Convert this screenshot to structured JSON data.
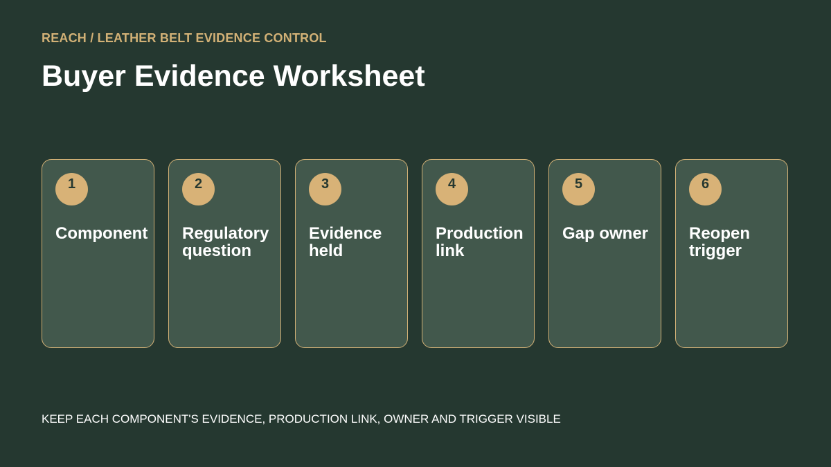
{
  "header": {
    "eyebrow": "REACH / LEATHER BELT EVIDENCE CONTROL",
    "title": "Buyer Evidence Worksheet"
  },
  "cards": [
    {
      "number": "1",
      "label": "Component"
    },
    {
      "number": "2",
      "label": "Regulatory question"
    },
    {
      "number": "3",
      "label": "Evidence held"
    },
    {
      "number": "4",
      "label": "Production link"
    },
    {
      "number": "5",
      "label": "Gap owner"
    },
    {
      "number": "6",
      "label": "Reopen trigger"
    }
  ],
  "footer": {
    "note": "KEEP EACH COMPONENT'S EVIDENCE, PRODUCTION LINK, OWNER AND TRIGGER VISIBLE"
  },
  "colors": {
    "background": "#253830",
    "card_fill": "#42584c",
    "accent": "#d2b176",
    "text": "#ffffff"
  }
}
